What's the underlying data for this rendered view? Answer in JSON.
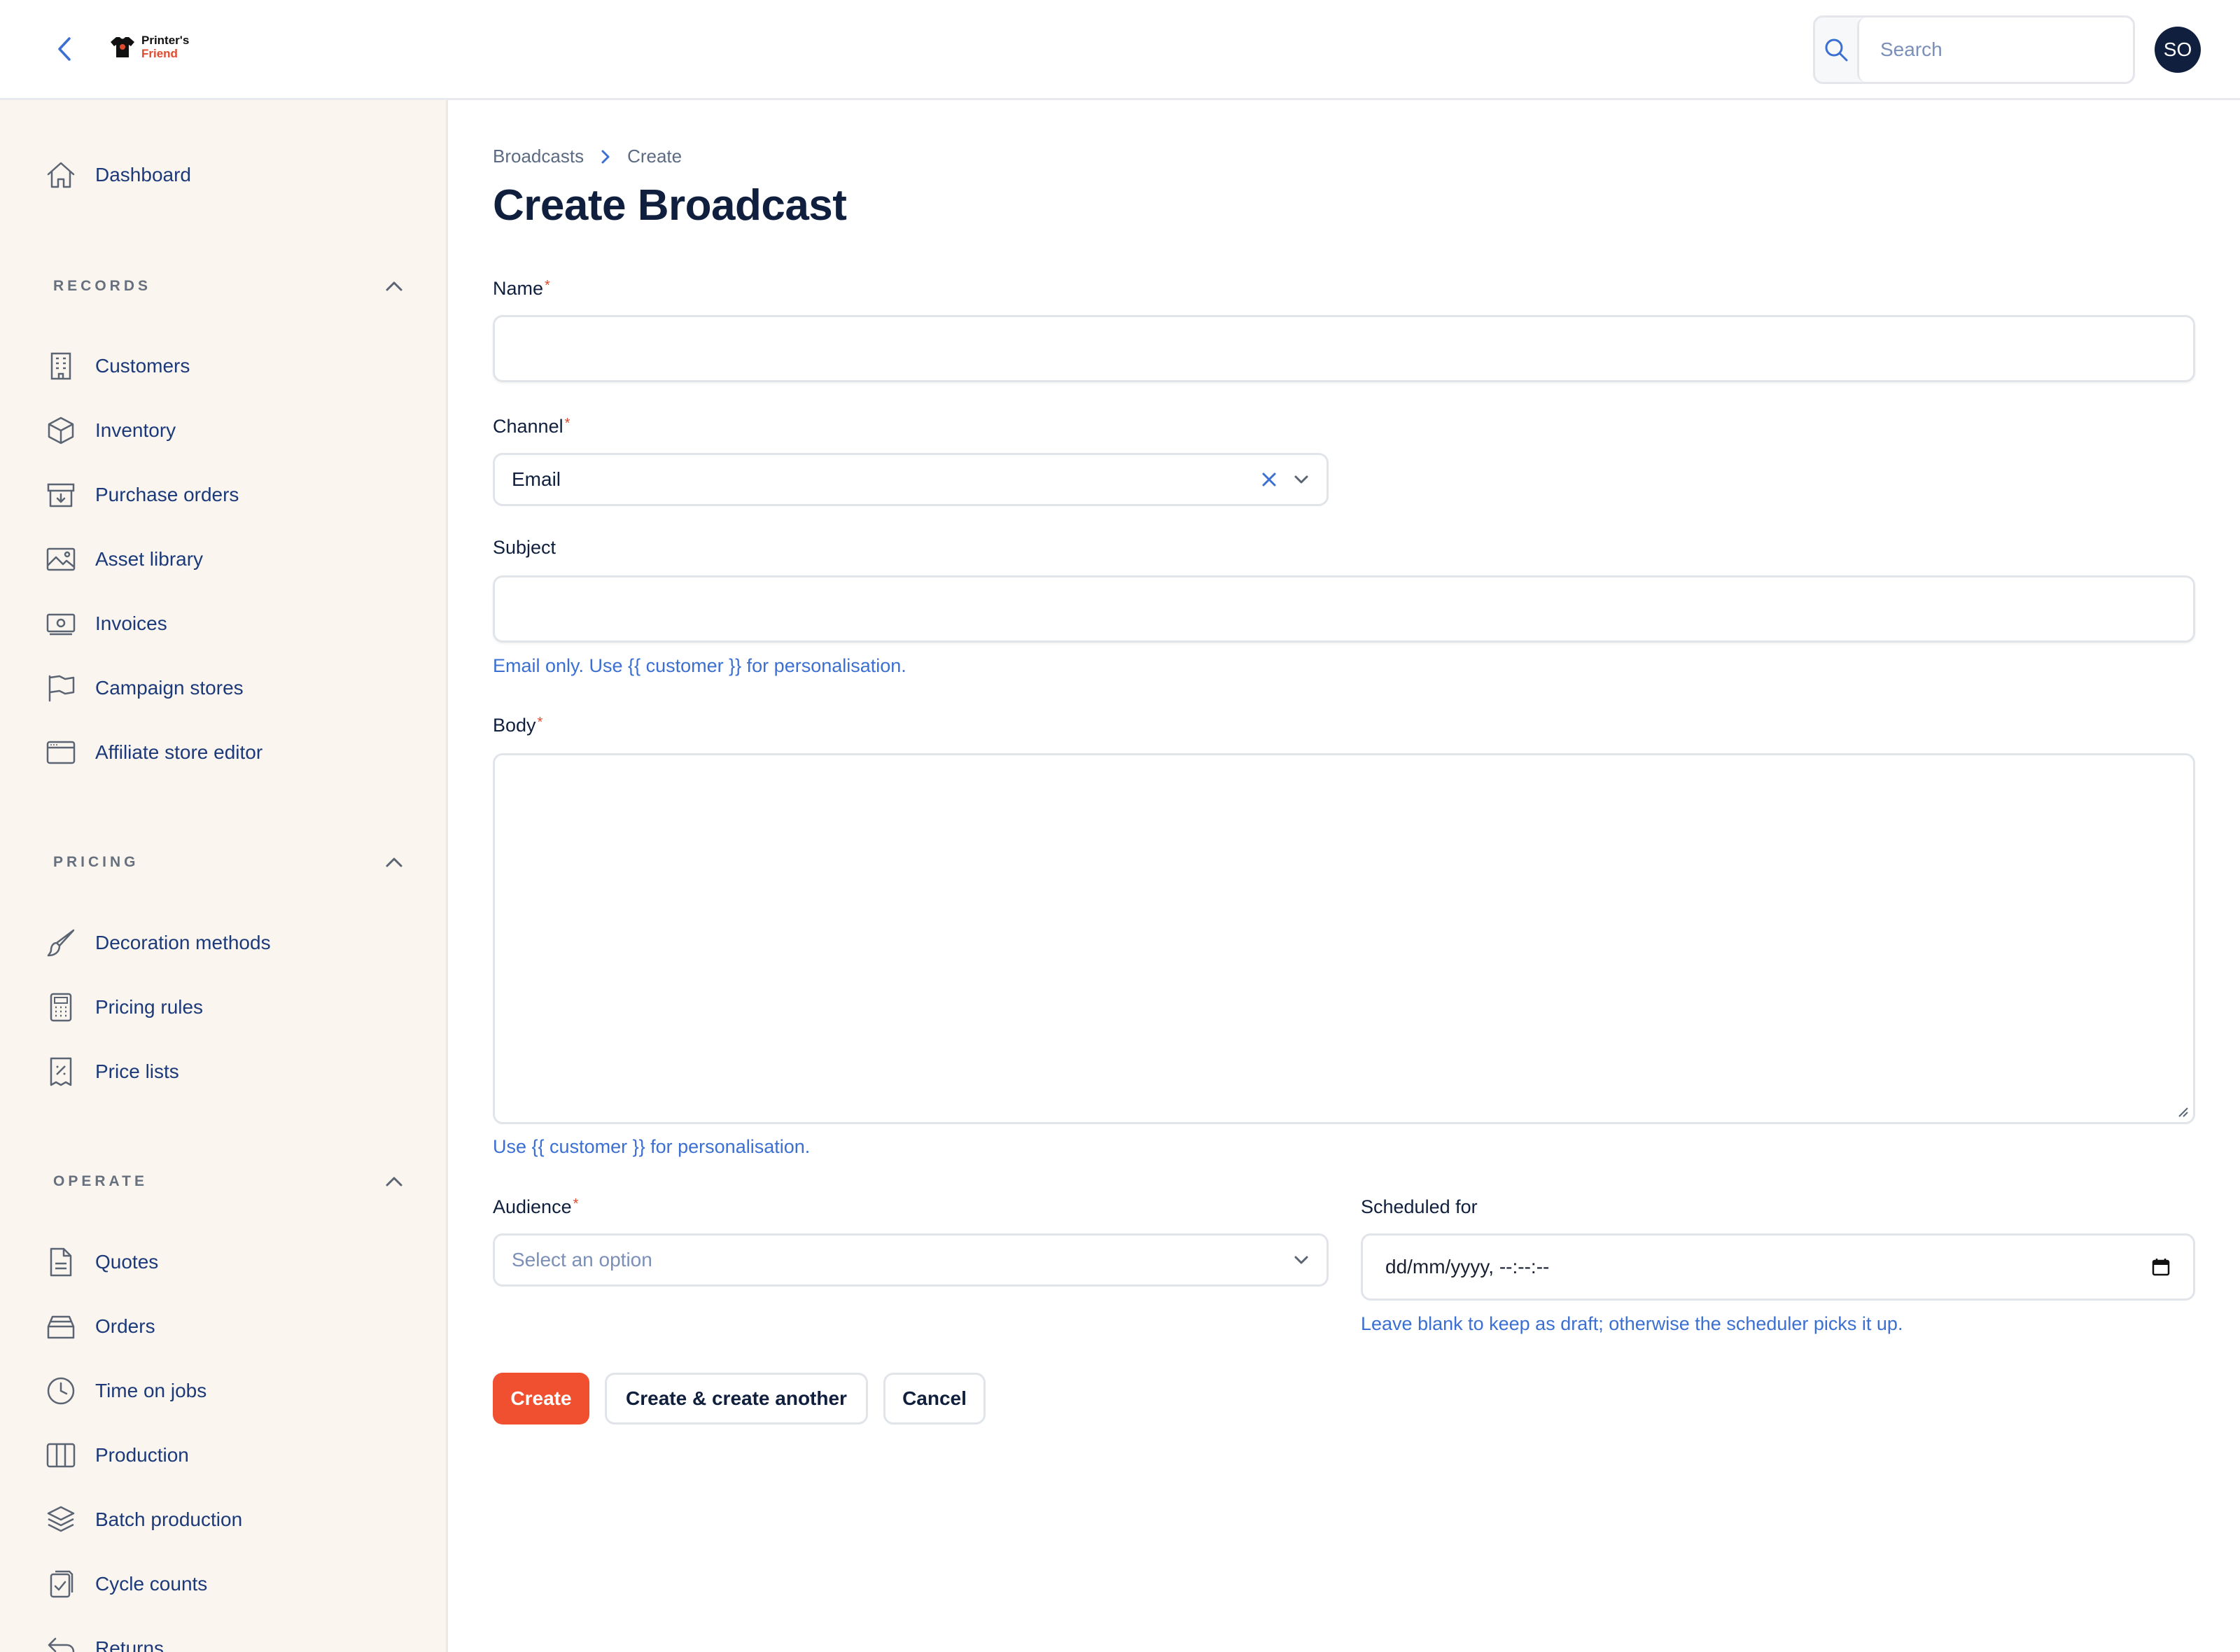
{
  "topbar": {
    "logo_line1": "Printer's",
    "logo_line2": "Friend",
    "search_placeholder": "Search",
    "avatar_initials": "SO"
  },
  "sidebar": {
    "dashboard": {
      "label": "Dashboard",
      "icon": "home-icon"
    },
    "groups": [
      {
        "label": "RECORDS",
        "items": [
          {
            "label": "Customers",
            "icon": "building-icon"
          },
          {
            "label": "Inventory",
            "icon": "cube-icon"
          },
          {
            "label": "Purchase orders",
            "icon": "archive-box-icon"
          },
          {
            "label": "Asset library",
            "icon": "photo-icon"
          },
          {
            "label": "Invoices",
            "icon": "banknotes-icon"
          },
          {
            "label": "Campaign stores",
            "icon": "flag-icon"
          },
          {
            "label": "Affiliate store editor",
            "icon": "window-icon"
          }
        ]
      },
      {
        "label": "PRICING",
        "items": [
          {
            "label": "Decoration methods",
            "icon": "paint-brush-icon"
          },
          {
            "label": "Pricing rules",
            "icon": "calculator-icon"
          },
          {
            "label": "Price lists",
            "icon": "receipt-percent-icon"
          }
        ]
      },
      {
        "label": "OPERATE",
        "items": [
          {
            "label": "Quotes",
            "icon": "document-icon"
          },
          {
            "label": "Orders",
            "icon": "inbox-stack-icon"
          },
          {
            "label": "Time on jobs",
            "icon": "clock-icon"
          },
          {
            "label": "Production",
            "icon": "view-columns-icon"
          },
          {
            "label": "Batch production",
            "icon": "square-stack-icon"
          },
          {
            "label": "Cycle counts",
            "icon": "clipboard-check-icon"
          },
          {
            "label": "Returns",
            "icon": "arrow-uturn-left-icon"
          }
        ]
      }
    ]
  },
  "main": {
    "breadcrumbs": [
      "Broadcasts",
      "Create"
    ],
    "title": "Create Broadcast",
    "form": {
      "name": {
        "label": "Name",
        "required_mark": "*",
        "value": ""
      },
      "channel": {
        "label": "Channel",
        "required_mark": "*",
        "value": "Email"
      },
      "subject": {
        "label": "Subject",
        "value": "",
        "hint": "Email only. Use {{ customer }} for personalisation."
      },
      "body": {
        "label": "Body",
        "required_mark": "*",
        "value": "",
        "hint": "Use {{ customer }} for personalisation."
      },
      "audience": {
        "label": "Audience",
        "required_mark": "*",
        "placeholder": "Select an option"
      },
      "scheduled_for": {
        "label": "Scheduled for",
        "placeholder": "dd/mm/yyyy, --:--:--",
        "hint": "Leave blank to keep as draft; otherwise the scheduler picks it up."
      }
    },
    "actions": {
      "create": "Create",
      "create_another": "Create & create another",
      "cancel": "Cancel"
    }
  },
  "colors": {
    "accent": "#f0502f",
    "link": "#3b6fd1",
    "sidebar_bg": "#faf5ef",
    "heading": "#0f1f3d"
  }
}
